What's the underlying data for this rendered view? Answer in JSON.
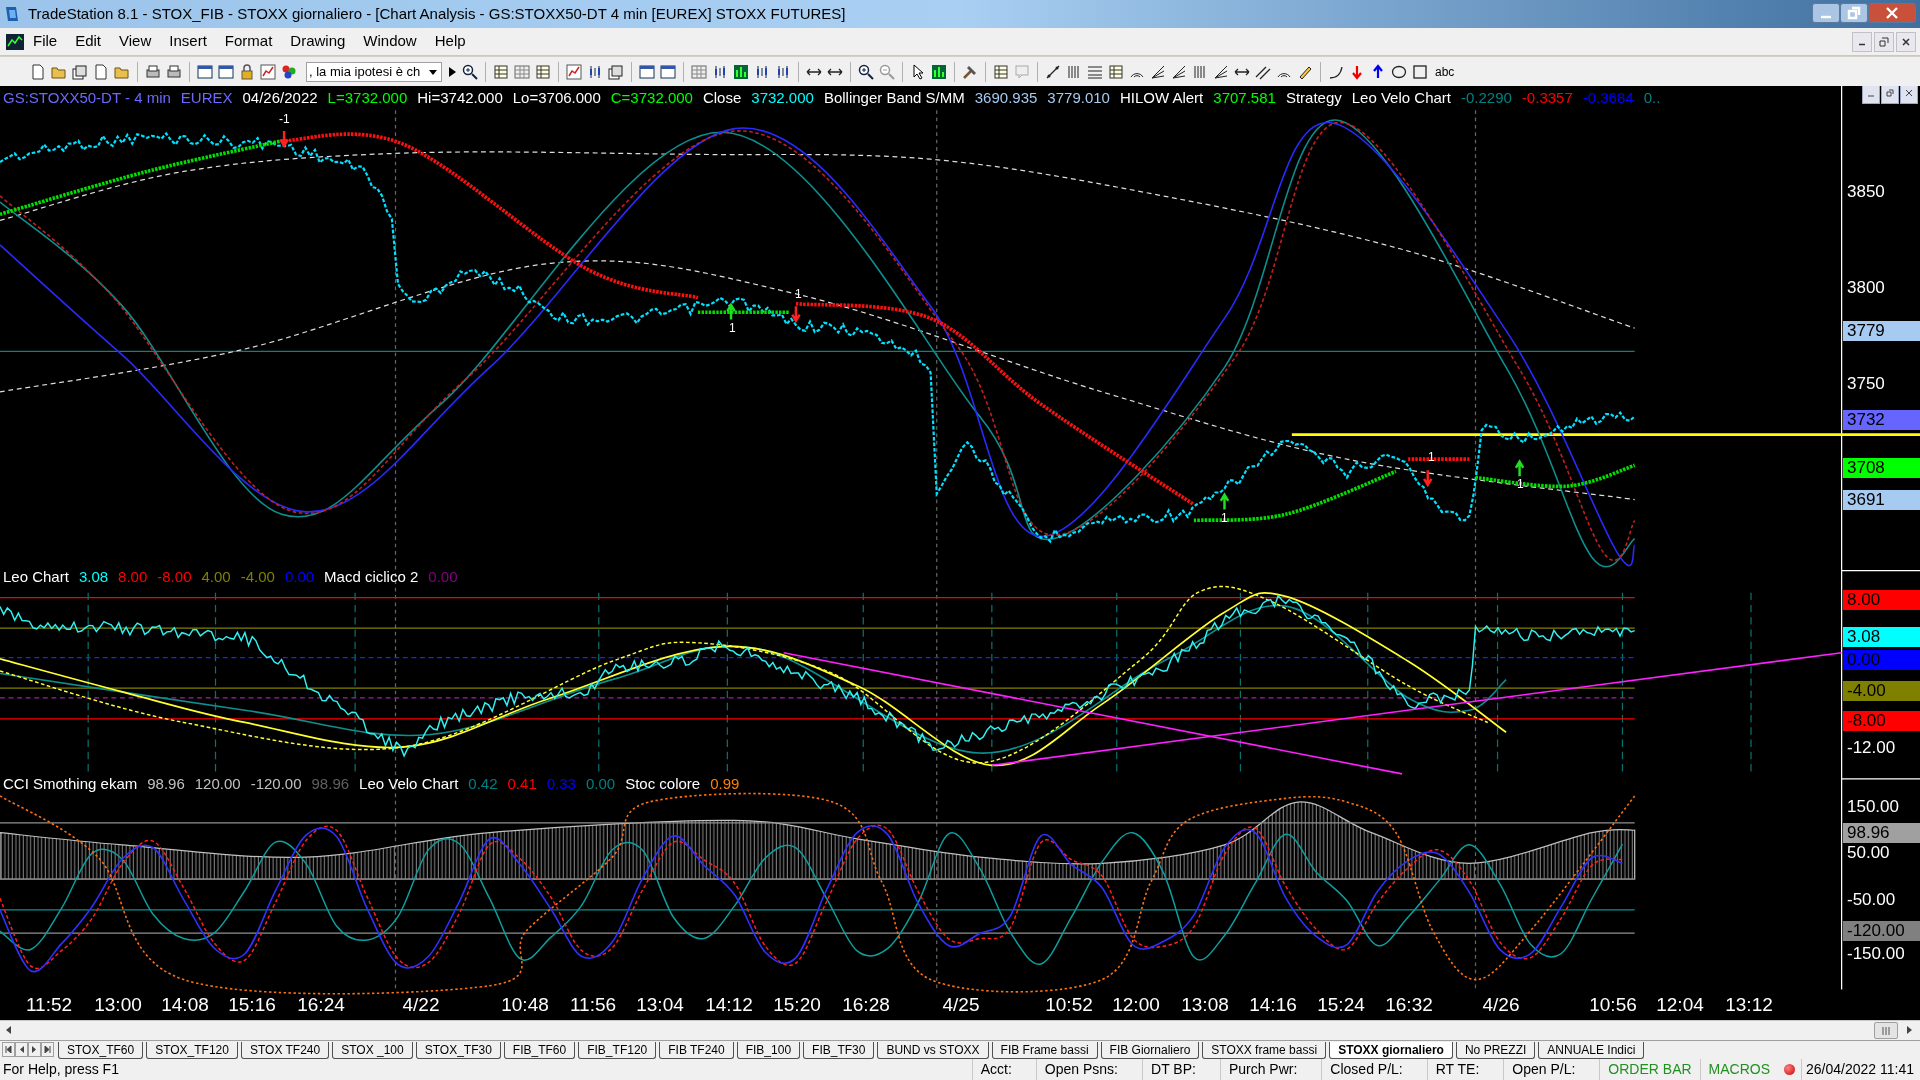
{
  "window": {
    "title": "TradeStation 8.1 - STOX_FIB - STOXX giornaliero - [Chart Analysis - GS:STOXX50-DT  4 min  [EUREX] STOXX FUTURES]"
  },
  "menu": [
    "File",
    "Edit",
    "View",
    "Insert",
    "Format",
    "Drawing",
    "Window",
    "Help"
  ],
  "toolbar": {
    "combo_value": ", la mia ipotesi è ch",
    "text_tool": "abc"
  },
  "main_chart": {
    "header": [
      {
        "text": "GS:STOXX50-DT - 4 min",
        "color": "#6a6aff"
      },
      {
        "text": "EUREX",
        "color": "#6a6aff"
      },
      {
        "text": "04/26/2022",
        "color": "#ffffff"
      },
      {
        "text": "L=3732.000",
        "color": "#00ff00"
      },
      {
        "text": "Hi=3742.000",
        "color": "#ffffff"
      },
      {
        "text": "Lo=3706.000",
        "color": "#ffffff"
      },
      {
        "text": "C=3732.000",
        "color": "#00ff00"
      },
      {
        "text": "Close",
        "color": "#ffffff"
      },
      {
        "text": "3732.000",
        "color": "#00ffff"
      },
      {
        "text": "Bollinger Band S/MM",
        "color": "#ffffff"
      },
      {
        "text": "3690.935",
        "color": "#a6caf0"
      },
      {
        "text": "3779.010",
        "color": "#a6caf0"
      },
      {
        "text": "HILOW Alert",
        "color": "#ffffff"
      },
      {
        "text": "3707.581",
        "color": "#00ff00"
      },
      {
        "text": "Strategy",
        "color": "#ffffff"
      },
      {
        "text": "Leo Velo Chart",
        "color": "#ffffff"
      },
      {
        "text": "-0.2290",
        "color": "#008080"
      },
      {
        "text": "-0.3357",
        "color": "#ff0000"
      },
      {
        "text": "-0.3684",
        "color": "#0000ff"
      },
      {
        "text": "0..",
        "color": "#008080"
      }
    ],
    "axis_labels": [
      "3850",
      "3800",
      "3750"
    ],
    "tags": [
      {
        "text": "3779",
        "color": "#a6caf0"
      },
      {
        "text": "3732",
        "color": "#6666ff"
      },
      {
        "text": "3708",
        "color": "#00ff00"
      },
      {
        "text": "3691",
        "color": "#a6caf0"
      }
    ],
    "markers": [
      "-1",
      "1",
      "1",
      "1",
      "1",
      "1"
    ]
  },
  "panel_1": {
    "header": [
      {
        "text": "Leo Chart",
        "color": "#ffffff"
      },
      {
        "text": "3.08",
        "color": "#00ffff"
      },
      {
        "text": "8.00",
        "color": "#ff0000"
      },
      {
        "text": "-8.00",
        "color": "#ff0000"
      },
      {
        "text": "4.00",
        "color": "#808000"
      },
      {
        "text": "-4.00",
        "color": "#808000"
      },
      {
        "text": "0.00",
        "color": "#0000ff"
      },
      {
        "text": "Macd ciclico 2",
        "color": "#ffffff"
      },
      {
        "text": "0.00",
        "color": "#800080"
      }
    ],
    "axis_labels": [
      "-12.00"
    ],
    "tags": [
      {
        "text": "8.00",
        "color": "#ff0000"
      },
      {
        "text": "3.08",
        "color": "#00ffff"
      },
      {
        "text": "0.00",
        "color": "#0000ff"
      },
      {
        "text": "-4.00",
        "color": "#808000"
      },
      {
        "text": "-8.00",
        "color": "#ff0000"
      }
    ]
  },
  "panel_2": {
    "header": [
      {
        "text": "CCI Smothing ekam",
        "color": "#ffffff"
      },
      {
        "text": "98.96",
        "color": "#c0c0c0"
      },
      {
        "text": "120.00",
        "color": "#c0c0c0"
      },
      {
        "text": "-120.00",
        "color": "#c0c0c0"
      },
      {
        "text": "98.96",
        "color": "#606060"
      },
      {
        "text": "Leo Velo Chart",
        "color": "#ffffff"
      },
      {
        "text": "0.42",
        "color": "#008080"
      },
      {
        "text": "0.41",
        "color": "#ff0000"
      },
      {
        "text": "0.33",
        "color": "#0000ff"
      },
      {
        "text": "0.00",
        "color": "#008080"
      },
      {
        "text": "Stoc colore",
        "color": "#ffffff"
      },
      {
        "text": "0.99",
        "color": "#ff8000"
      }
    ],
    "axis_labels": [
      "150.00",
      "50.00",
      "-50.00",
      "-150.00"
    ],
    "tags": [
      {
        "text": "98.96",
        "color": "#a0a0a0"
      },
      {
        "text": "-120.00",
        "color": "#808080"
      }
    ]
  },
  "time_axis": [
    "11:52",
    "13:00",
    "14:08",
    "15:16",
    "16:24",
    "4/22",
    "10:48",
    "11:56",
    "13:04",
    "14:12",
    "15:20",
    "16:28",
    "4/25",
    "10:52",
    "12:00",
    "13:08",
    "14:16",
    "15:24",
    "16:32",
    "4/26",
    "10:56",
    "12:04",
    "13:12"
  ],
  "sheet_tabs": [
    {
      "label": "STOX_TF60",
      "selected": false
    },
    {
      "label": "STOX_TF120",
      "selected": false
    },
    {
      "label": "STOX TF240",
      "selected": false
    },
    {
      "label": "STOX _100",
      "selected": false
    },
    {
      "label": "STOX_TF30",
      "selected": false
    },
    {
      "label": "FIB_TF60",
      "selected": false
    },
    {
      "label": "FIB_TF120",
      "selected": false
    },
    {
      "label": "FIB TF240",
      "selected": false
    },
    {
      "label": "FIB_100",
      "selected": false
    },
    {
      "label": "FIB_TF30",
      "selected": false
    },
    {
      "label": "BUND vs STOXX",
      "selected": false
    },
    {
      "label": "FIB Frame bassi",
      "selected": false
    },
    {
      "label": "FIB Giornaliero",
      "selected": false
    },
    {
      "label": "STOXX frame bassi",
      "selected": false
    },
    {
      "label": "STOXX giornaliero",
      "selected": true
    },
    {
      "label": "No PREZZI",
      "selected": false
    },
    {
      "label": "ANNUALE Indici",
      "selected": false
    }
  ],
  "status_bar": {
    "help": "For Help, press F1",
    "fields": [
      {
        "text": "Acct:",
        "color": "#000000"
      },
      {
        "text": "Open Psns:",
        "color": "#000000"
      },
      {
        "text": "DT BP:",
        "color": "#000000"
      },
      {
        "text": "Purch Pwr:",
        "color": "#000000"
      },
      {
        "text": "Closed P/L:",
        "color": "#000000"
      },
      {
        "text": "RT TE:",
        "color": "#000000"
      },
      {
        "text": "Open P/L:",
        "color": "#000000"
      },
      {
        "text": "ORDER BAR",
        "color": "#209020"
      },
      {
        "text": "MACROS",
        "color": "#209020"
      }
    ],
    "datetime": "26/04/2022 11:41"
  }
}
